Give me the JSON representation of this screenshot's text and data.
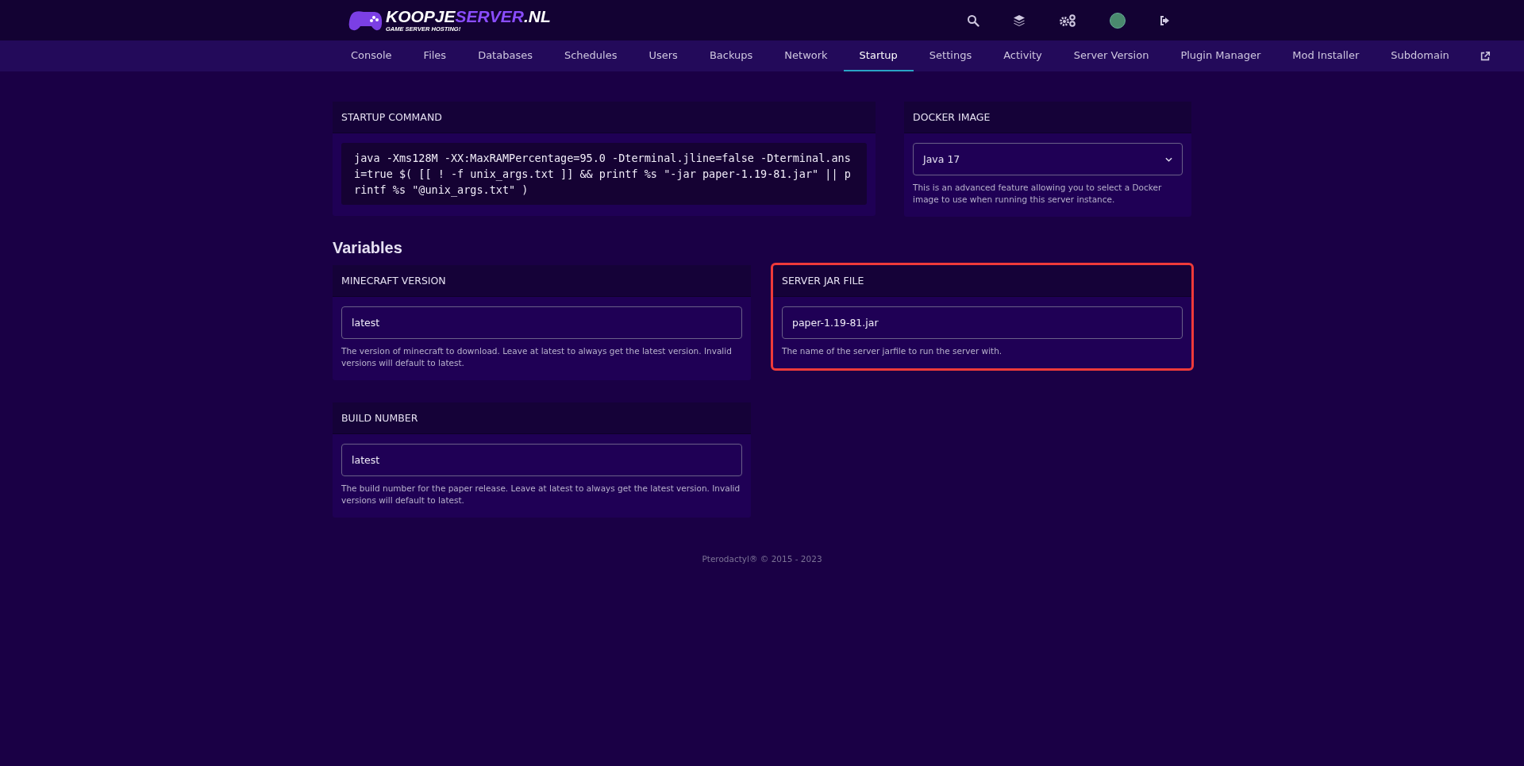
{
  "logo": {
    "brand": "KOOPJE",
    "accent": "SERVER",
    "suffix": ".NL",
    "tagline": "GAME SERVER HOSTING!"
  },
  "header_icons": [
    {
      "kind": "search"
    },
    {
      "kind": "layers"
    },
    {
      "kind": "cogs"
    },
    {
      "kind": "avatar"
    },
    {
      "kind": "logout"
    }
  ],
  "tabs": [
    {
      "label": "Console",
      "selected": false
    },
    {
      "label": "Files",
      "selected": false
    },
    {
      "label": "Databases",
      "selected": false
    },
    {
      "label": "Schedules",
      "selected": false
    },
    {
      "label": "Users",
      "selected": false
    },
    {
      "label": "Backups",
      "selected": false
    },
    {
      "label": "Network",
      "selected": false
    },
    {
      "label": "Startup",
      "selected": true
    },
    {
      "label": "Settings",
      "selected": false
    },
    {
      "label": "Activity",
      "selected": false
    },
    {
      "label": "Server Version",
      "selected": false
    },
    {
      "label": "Plugin Manager",
      "selected": false
    },
    {
      "label": "Mod Installer",
      "selected": false
    },
    {
      "label": "Subdomain",
      "selected": false
    }
  ],
  "startup_command": {
    "title": "STARTUP COMMAND",
    "command": "java -Xms128M -XX:MaxRAMPercentage=95.0 -Dterminal.jline=false -Dterminal.ansi=true $( [[ ! -f unix_args.txt ]] && printf %s \"-jar paper-1.19-81.jar\" || printf %s \"@unix_args.txt\" )"
  },
  "docker_image": {
    "title": "DOCKER IMAGE",
    "value": "Java 17",
    "description": "This is an advanced feature allowing you to select a Docker image to use when running this server instance."
  },
  "variables_heading": "Variables",
  "variables": [
    {
      "title": "MINECRAFT VERSION",
      "value": "latest",
      "description": "The version of minecraft to download. Leave at latest to always get the latest version. Invalid versions will default to latest.",
      "highlighted": false
    },
    {
      "title": "SERVER JAR FILE",
      "value": "paper-1.19-81.jar",
      "description": "The name of the server jarfile to run the server with.",
      "highlighted": true
    },
    {
      "title": "BUILD NUMBER",
      "value": "latest",
      "description": "The build number for the paper release. Leave at latest to always get the latest version. Invalid versions will default to latest.",
      "highlighted": false
    }
  ],
  "footer": "Pterodactyl® © 2015 - 2023"
}
